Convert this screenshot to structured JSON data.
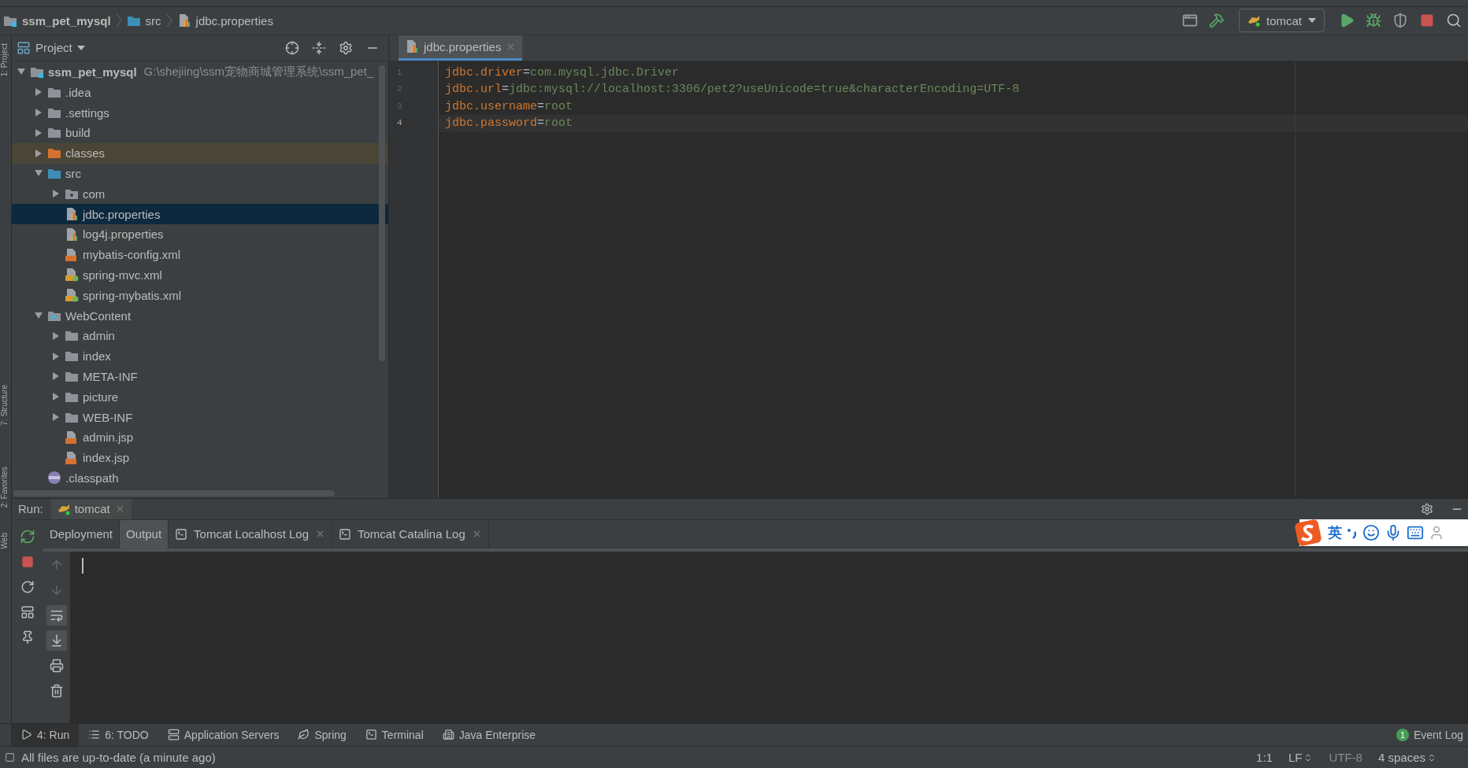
{
  "breadcrumb": [
    {
      "label": "ssm_pet_mysql",
      "kind": "module"
    },
    {
      "label": "src",
      "kind": "source"
    },
    {
      "label": "jdbc.properties",
      "kind": "properties"
    }
  ],
  "toolbar": {
    "run_config": "tomcat"
  },
  "side_tools": [
    "1: Project",
    "7: Structure",
    "2: Favorites",
    "Web"
  ],
  "project": {
    "title": "Project",
    "tree": [
      {
        "label": "ssm_pet_mysql",
        "path": "G:\\shejiing\\ssm宠物商城管理系统\\ssm_pet_",
        "kind": "module",
        "expanded": true,
        "selected": false,
        "children": [
          {
            "label": ".idea",
            "kind": "folder",
            "expanded": false,
            "selected": false
          },
          {
            "label": ".settings",
            "kind": "folder",
            "expanded": false,
            "selected": false
          },
          {
            "label": "build",
            "kind": "folder",
            "expanded": false,
            "selected": false
          },
          {
            "label": "classes",
            "kind": "excluded",
            "expanded": false,
            "selected": false
          },
          {
            "label": "src",
            "kind": "source",
            "expanded": true,
            "selected": false,
            "children": [
              {
                "label": "com",
                "kind": "package",
                "expanded": false,
                "selected": false
              },
              {
                "label": "jdbc.properties",
                "kind": "properties",
                "selected": true
              },
              {
                "label": "log4j.properties",
                "kind": "properties",
                "selected": false
              },
              {
                "label": "mybatis-config.xml",
                "kind": "xml",
                "selected": false
              },
              {
                "label": "spring-mvc.xml",
                "kind": "spring",
                "selected": false
              },
              {
                "label": "spring-mybatis.xml",
                "kind": "spring",
                "selected": false
              }
            ]
          },
          {
            "label": "WebContent",
            "kind": "web",
            "expanded": true,
            "selected": false,
            "children": [
              {
                "label": "admin",
                "kind": "folder",
                "expanded": false,
                "selected": false
              },
              {
                "label": "index",
                "kind": "folder",
                "expanded": false,
                "selected": false
              },
              {
                "label": "META-INF",
                "kind": "folder",
                "expanded": false,
                "selected": false
              },
              {
                "label": "picture",
                "kind": "folder",
                "expanded": false,
                "selected": false
              },
              {
                "label": "WEB-INF",
                "kind": "folder",
                "expanded": false,
                "selected": false
              },
              {
                "label": "admin.jsp",
                "kind": "jsp",
                "selected": false
              },
              {
                "label": "index.jsp",
                "kind": "jsp",
                "selected": false
              }
            ]
          },
          {
            "label": ".classpath",
            "kind": "classpath",
            "selected": false
          }
        ]
      }
    ]
  },
  "editor": {
    "tabs": [
      {
        "label": "jdbc.properties",
        "selected": true
      }
    ],
    "lines": [
      {
        "number": "1",
        "key": "jdbc.driver",
        "sep": "=",
        "value": "com.mysql.jdbc.Driver",
        "current": false
      },
      {
        "number": "2",
        "key": "jdbc.url",
        "sep": "=",
        "value": "jdbc:mysql://localhost:3306/pet2?useUnicode=true&characterEncoding=UTF-8",
        "current": false
      },
      {
        "number": "3",
        "key": "jdbc.username",
        "sep": "=",
        "value": "root",
        "current": false
      },
      {
        "number": "4",
        "key": "jdbc.password",
        "sep": "=",
        "value": "root",
        "current": true
      }
    ]
  },
  "run": {
    "label": "Run:",
    "tab": "tomcat",
    "subtabs": [
      {
        "label": "Deployment",
        "selected": false,
        "closable": false
      },
      {
        "label": "Output",
        "selected": true,
        "closable": false
      },
      {
        "label": "Tomcat Localhost Log",
        "selected": false,
        "closable": true
      },
      {
        "label": "Tomcat Catalina Log",
        "selected": false,
        "closable": true
      }
    ],
    "console_tools": [
      {
        "kind": "up",
        "disabled": true,
        "on": false
      },
      {
        "kind": "down",
        "disabled": true,
        "on": false
      },
      {
        "kind": "wrap",
        "disabled": false,
        "on": true
      },
      {
        "kind": "scroll",
        "disabled": false,
        "on": true
      },
      {
        "kind": "print",
        "disabled": false,
        "on": false
      },
      {
        "kind": "clear",
        "disabled": false,
        "on": false
      }
    ]
  },
  "ime": {
    "mode": "英"
  },
  "tool_tabs": [
    {
      "label": "4: Run",
      "kind": "run",
      "selected": true
    },
    {
      "label": "6: TODO",
      "kind": "todo",
      "selected": false
    },
    {
      "label": "Application Servers",
      "kind": "servers",
      "selected": false
    },
    {
      "label": "Spring",
      "kind": "spring",
      "selected": false
    },
    {
      "label": "Terminal",
      "kind": "terminal",
      "selected": false
    },
    {
      "label": "Java Enterprise",
      "kind": "enterprise",
      "selected": false
    }
  ],
  "event_log": {
    "label": "Event Log",
    "count": "1"
  },
  "status_bar": {
    "message": "All files are up-to-date (a minute ago)",
    "position": "1:1",
    "line_sep": "LF",
    "encoding": "UTF-8",
    "indent": "4 spaces"
  }
}
